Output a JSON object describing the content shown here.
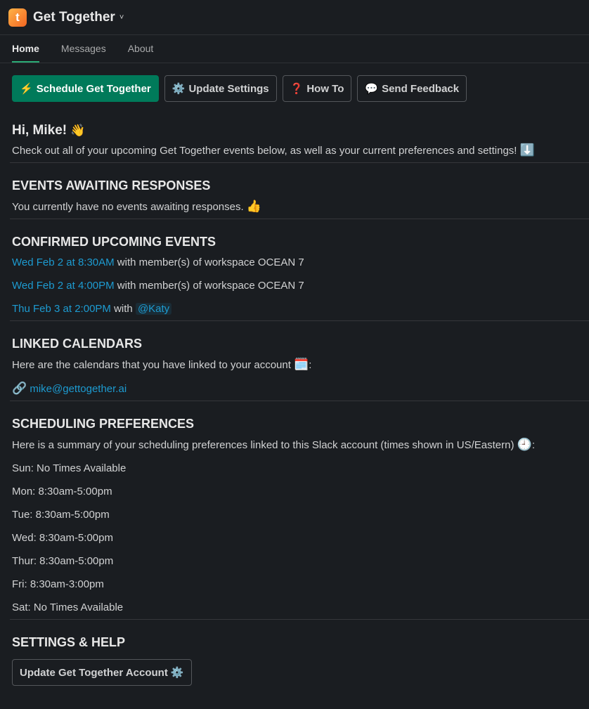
{
  "app": {
    "title": "Get Together",
    "logo_letter": "t",
    "chevron": "˅"
  },
  "tabs": [
    {
      "label": "Home",
      "active": true
    },
    {
      "label": "Messages",
      "active": false
    },
    {
      "label": "About",
      "active": false
    }
  ],
  "buttons": [
    {
      "icon": "⚡",
      "label": "Schedule Get Together"
    },
    {
      "icon": "⚙️",
      "label": "Update Settings"
    },
    {
      "icon": "❓",
      "label": "How To"
    },
    {
      "icon": "💬",
      "label": "Send Feedback"
    }
  ],
  "greeting": {
    "title": "Hi, Mike!",
    "emoji": "👋",
    "text": "Check out all of your upcoming Get Together events below, as well as your current preferences and settings!",
    "text_emoji": "⬇️"
  },
  "awaiting": {
    "heading": "EVENTS AWAITING RESPONSES",
    "text": "You currently have no events awaiting responses.",
    "emoji": "👍"
  },
  "confirmed": {
    "heading": "CONFIRMED UPCOMING EVENTS",
    "events": [
      {
        "time": "Wed Feb 2 at 8:30AM",
        "rest": " with member(s) of workspace OCEAN 7",
        "mention": ""
      },
      {
        "time": "Wed Feb 2 at 4:00PM",
        "rest": " with member(s) of workspace OCEAN 7",
        "mention": ""
      },
      {
        "time": "Thu Feb 3 at 2:00PM",
        "rest": " with ",
        "mention": "@Katy"
      }
    ]
  },
  "calendars": {
    "heading": "LINKED CALENDARS",
    "text": "Here are the calendars that you have linked to your account",
    "emoji": "🗓️",
    "suffix": ":",
    "link_emoji": "🔗",
    "email": "mike@gettogether.ai"
  },
  "preferences": {
    "heading": "SCHEDULING PREFERENCES",
    "text": "Here is a summary of your scheduling preferences linked to this Slack account (times shown in US/Eastern)",
    "emoji": "🕘",
    "suffix": ":",
    "days": [
      "Sun: No Times Available",
      "Mon: 8:30am-5:00pm",
      "Tue: 8:30am-5:00pm",
      "Wed: 8:30am-5:00pm",
      "Thur: 8:30am-5:00pm",
      "Fri: 8:30am-3:00pm",
      "Sat: No Times Available"
    ]
  },
  "settings": {
    "heading": "SETTINGS & HELP",
    "button_label": "Update Get Together Account",
    "button_icon": "⚙️"
  }
}
